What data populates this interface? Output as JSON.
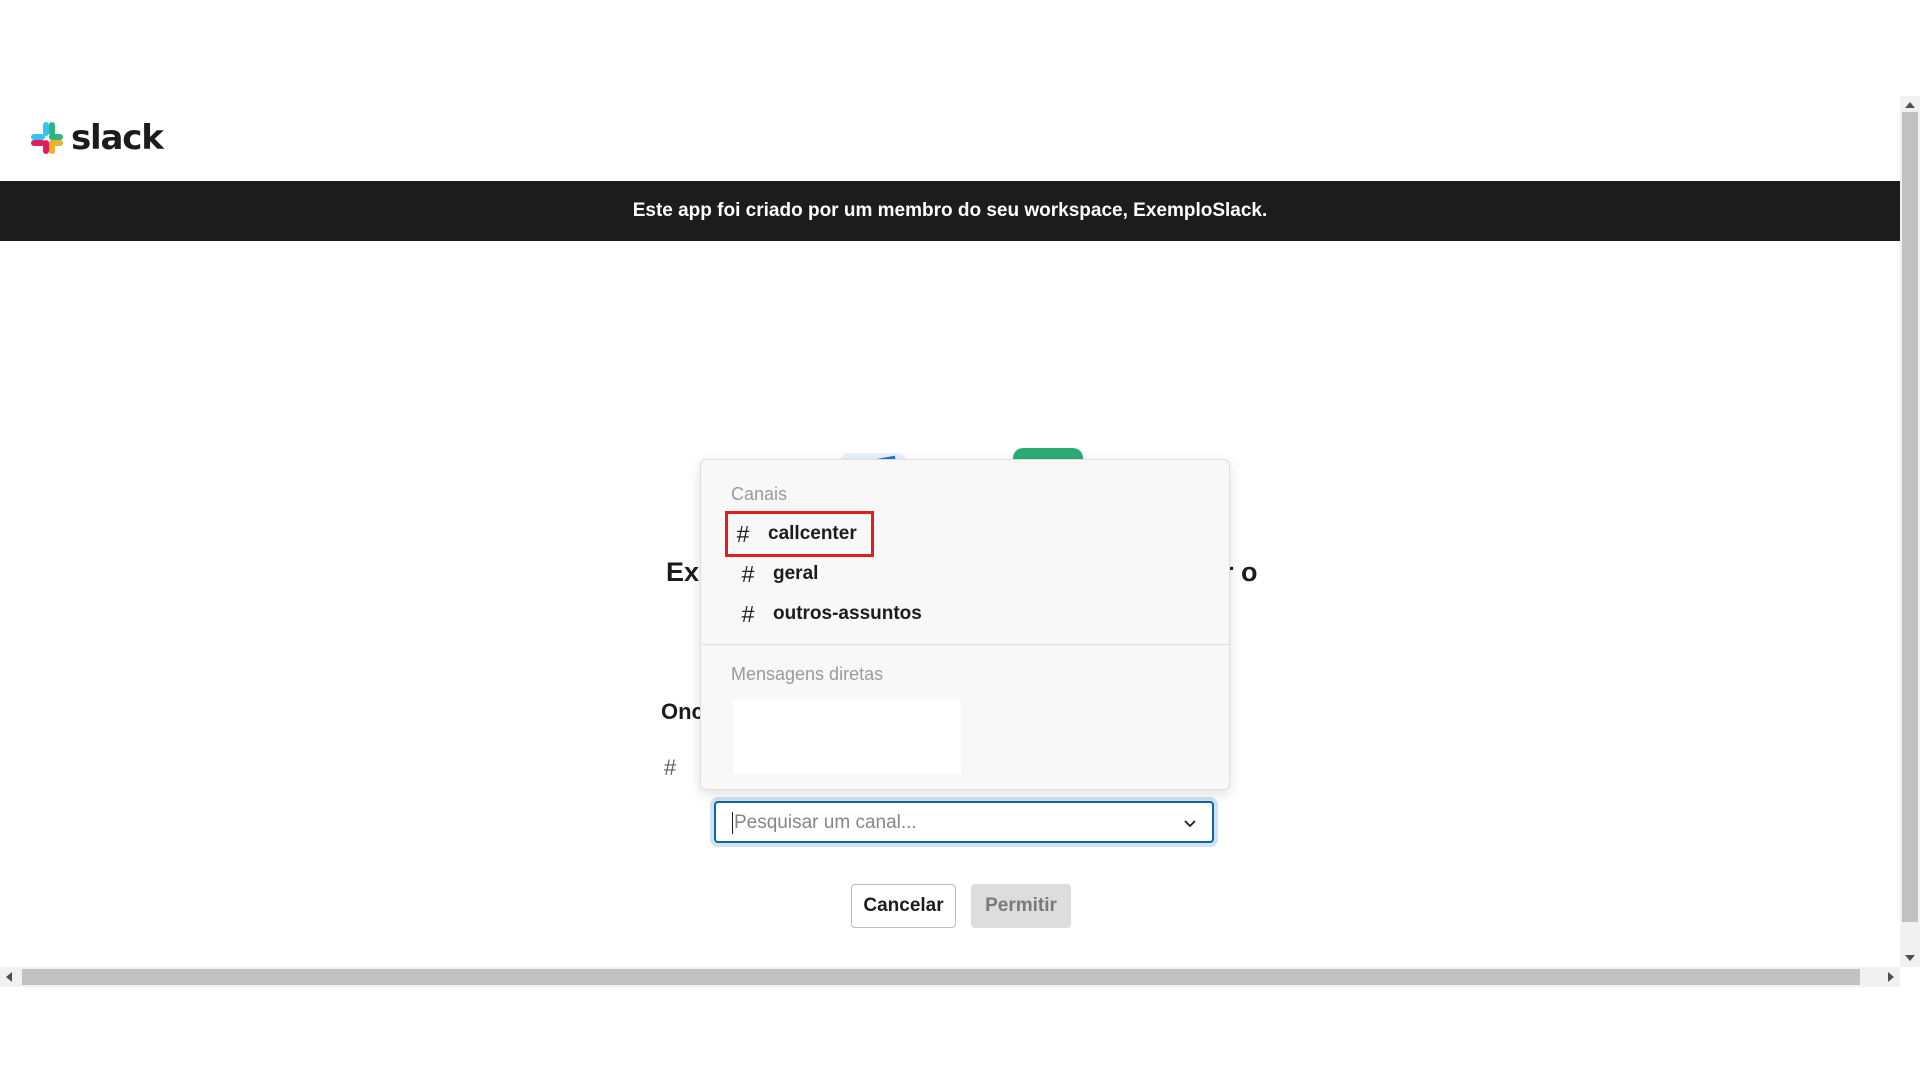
{
  "header": {
    "logo_text": "slack",
    "banner_text": "Este app foi criado por um membro do seu workspace, ExemploSlack."
  },
  "main": {
    "heading_left": "Ex",
    "heading_right": "r o",
    "subheading": "Onc",
    "hash_symbol": "#",
    "search_placeholder": "Pesquisar um canal...",
    "cancel_label": "Cancelar",
    "allow_label": "Permitir"
  },
  "dropdown": {
    "channels_label": "Canais",
    "channels": [
      {
        "name": "callcenter",
        "highlighted": true
      },
      {
        "name": "geral",
        "highlighted": false
      },
      {
        "name": "outros-assuntos",
        "highlighted": false
      }
    ],
    "dm_label": "Mensagens diretas"
  },
  "colors": {
    "banner_bg": "#1d1c1d",
    "focus_border": "#1264a3",
    "highlight": "#e01e1e",
    "brand_green": "#2bac76"
  }
}
